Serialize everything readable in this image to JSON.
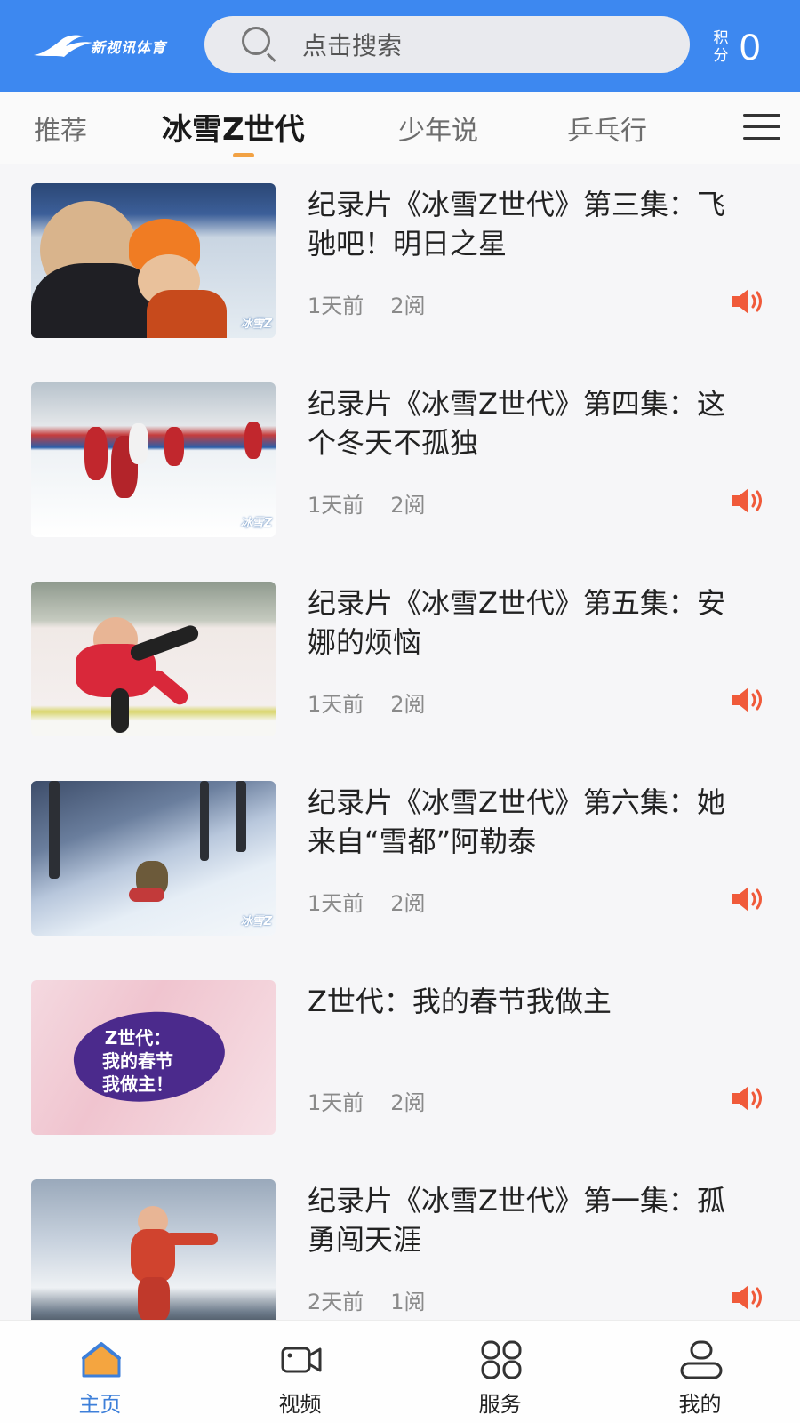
{
  "header": {
    "logo_text": "新视讯体育",
    "search_placeholder": "点击搜索",
    "points_label": "积分",
    "points_value": "0"
  },
  "tabs": [
    {
      "label": "推荐",
      "active": false
    },
    {
      "label": "冰雪Z世代",
      "active": true
    },
    {
      "label": "少年说",
      "active": false
    },
    {
      "label": "乒乓行",
      "active": false
    }
  ],
  "thumbnail_watermark": "冰雪Z",
  "articles": [
    {
      "title": "纪录片《冰雪Z世代》第三集：飞驰吧！明日之星",
      "time": "1天前",
      "reads": "2阅"
    },
    {
      "title": "纪录片《冰雪Z世代》第四集：这个冬天不孤独",
      "time": "1天前",
      "reads": "2阅"
    },
    {
      "title": "纪录片《冰雪Z世代》第五集：安娜的烦恼",
      "time": "1天前",
      "reads": "2阅"
    },
    {
      "title": "纪录片《冰雪Z世代》第六集：她来自“雪都”阿勒泰",
      "time": "1天前",
      "reads": "2阅"
    },
    {
      "title": "Z世代：我的春节我做主",
      "time": "1天前",
      "reads": "2阅",
      "thumb_text": "Z世代：\n我的春节\n我做主！"
    },
    {
      "title": "纪录片《冰雪Z世代》第一集：孤勇闯天涯",
      "time": "2天前",
      "reads": "1阅"
    }
  ],
  "bottom_nav": [
    {
      "label": "主页",
      "icon": "home-icon",
      "active": true
    },
    {
      "label": "视频",
      "icon": "video-camera-icon",
      "active": false
    },
    {
      "label": "服务",
      "icon": "grid-icon",
      "active": false
    },
    {
      "label": "我的",
      "icon": "user-icon",
      "active": false
    }
  ],
  "colors": {
    "header_bg": "#3d88f0",
    "tab_indicator": "#f2a244",
    "audio_icon": "#f05a3a",
    "nav_active": "#3d7fd9"
  }
}
